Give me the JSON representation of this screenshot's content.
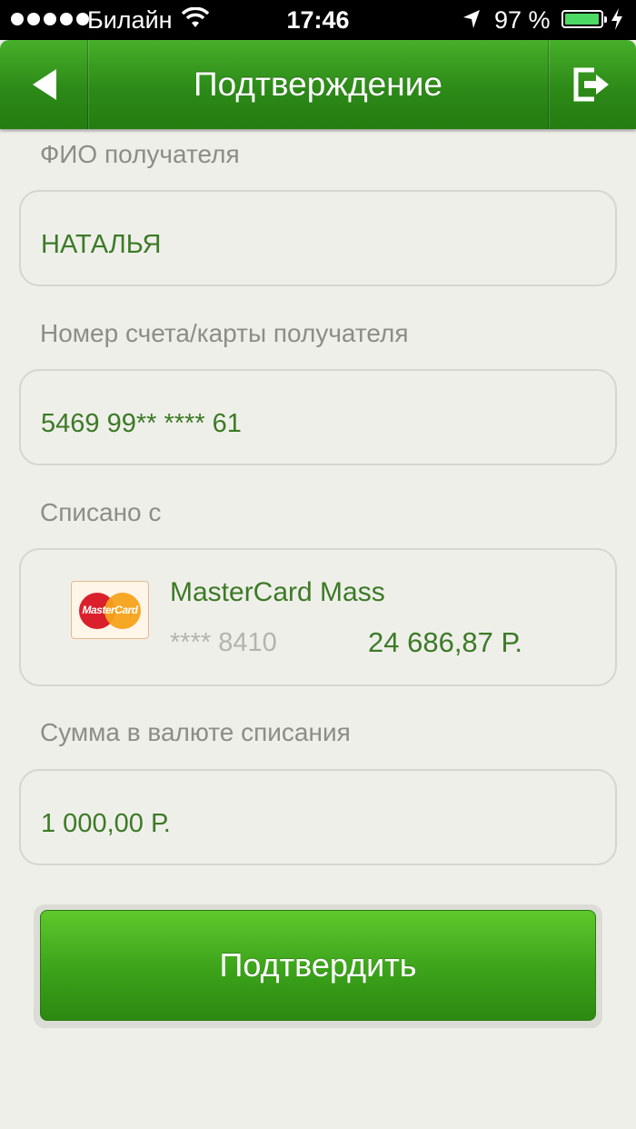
{
  "status_bar": {
    "carrier": "Билайн",
    "time": "17:46",
    "battery_percent": "97 %",
    "battery_level": 0.97
  },
  "header": {
    "title": "Подтверждение"
  },
  "form": {
    "recipient_name_label": "ФИО получателя",
    "recipient_name_value": "НАТАЛЬЯ",
    "account_label": "Номер счета/карты получателя",
    "account_value": "5469 99** **** 61",
    "debited_from_label": "Списано с",
    "card": {
      "name": "MasterCard Mass",
      "number": "**** 8410",
      "balance": "24 686,87 Р.",
      "logo_text": "MasterCard"
    },
    "amount_label": "Сумма в валюте списания",
    "amount_value": "1 000,00 Р."
  },
  "actions": {
    "confirm_label": "Подтвердить"
  },
  "colors": {
    "accent_green": "#3ba21a",
    "value_text": "#3c7a26",
    "label_text": "#8d8d88"
  }
}
